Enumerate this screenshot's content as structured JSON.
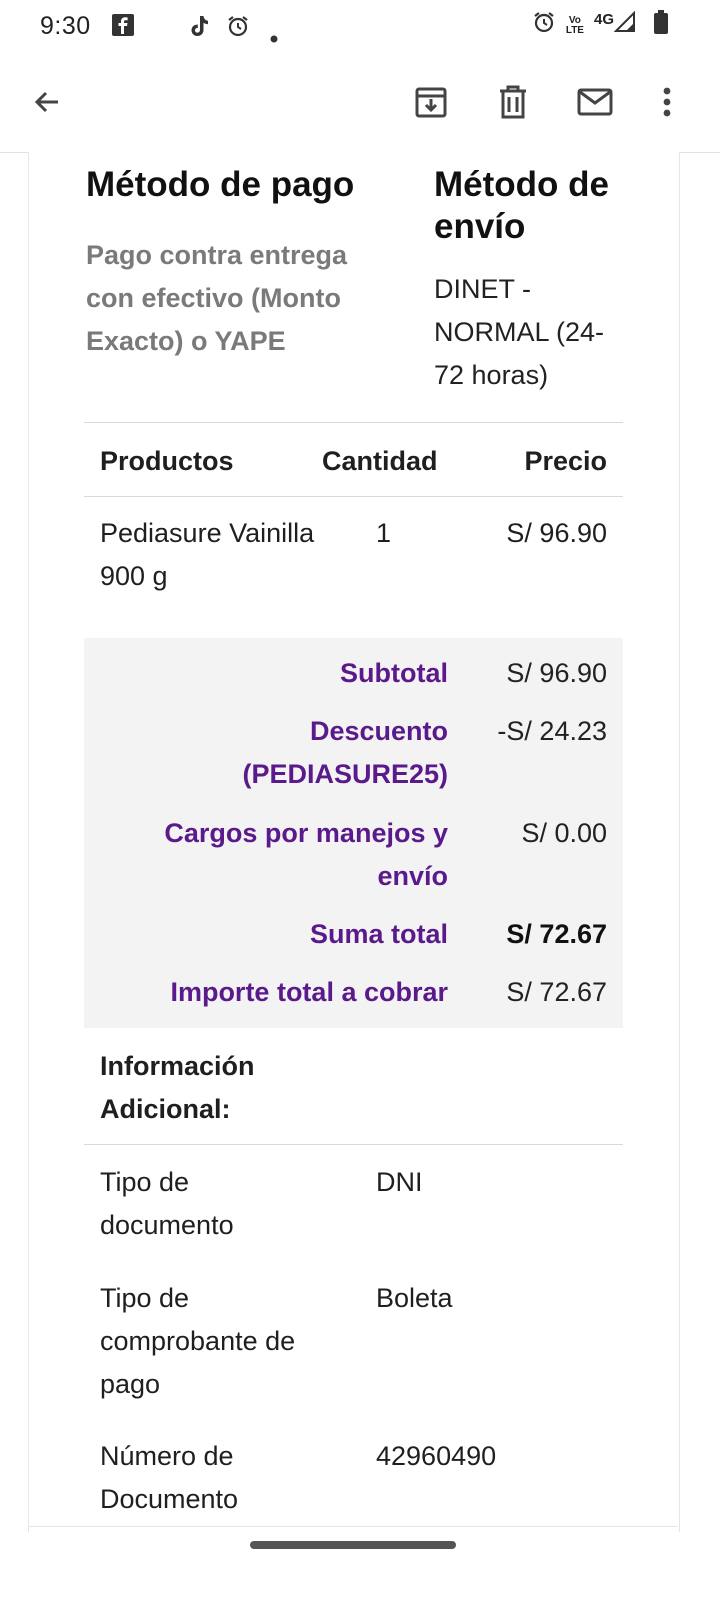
{
  "status_bar": {
    "time": "9:30",
    "volte_top": "Vo",
    "volte_bottom": "LTE",
    "network": "4G",
    "left_icons": [
      "facebook-icon",
      "tiktok-icon",
      "alarm-icon",
      "notification-dot-icon"
    ],
    "right_icons": [
      "alarm-icon",
      "volte-icon",
      "signal-icon",
      "battery-icon"
    ]
  },
  "app_bar": {
    "icons": [
      "back-arrow-icon",
      "archive-icon",
      "delete-icon",
      "mail-icon",
      "more-vert-icon"
    ]
  },
  "methods": {
    "payment_title": "Método de pago",
    "payment_text": "Pago contra entrega con efectivo (Monto Exacto) o YAPE",
    "shipping_title": "Método de envío",
    "shipping_text": "DINET - NORMAL (24-72 horas)"
  },
  "table": {
    "headers": {
      "products": "Productos",
      "quantity": "Cantidad",
      "price": "Precio"
    },
    "rows": [
      {
        "name": "Pediasure Vainilla 900 g",
        "quantity": "1",
        "price": "S/ 96.90"
      }
    ]
  },
  "summary": {
    "subtotal_label": "Subtotal",
    "subtotal_value": "S/ 96.90",
    "discount_label": "Descuento (PEDIASURE25)",
    "discount_value": "-S/ 24.23",
    "shipping_label": "Cargos por manejos y envío",
    "shipping_value": "S/ 0.00",
    "total_label": "Suma total",
    "total_value": "S/ 72.67",
    "charge_label": "Importe total a cobrar",
    "charge_value": "S/ 72.67",
    "label_color": "#5b1a8c"
  },
  "additional_info": {
    "title": "Información Adicional:",
    "rows": [
      {
        "key": "Tipo de documento",
        "value": "DNI"
      },
      {
        "key": "Tipo de comprobante de pago",
        "value": "Boleta"
      },
      {
        "key": "Número de Documento",
        "value": "42960490"
      }
    ]
  }
}
